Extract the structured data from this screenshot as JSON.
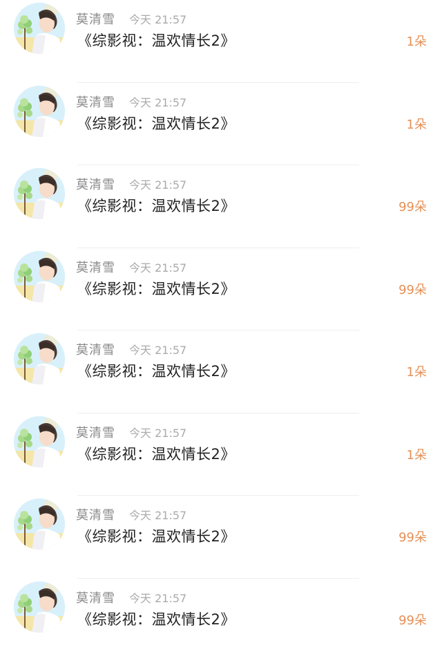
{
  "items": [
    {
      "name": "莫清雪",
      "time": "今天 21:57",
      "title": "《综影视：温欢情长2》",
      "amount": "1朵"
    },
    {
      "name": "莫清雪",
      "time": "今天 21:57",
      "title": "《综影视：温欢情长2》",
      "amount": "1朵"
    },
    {
      "name": "莫清雪",
      "time": "今天 21:57",
      "title": "《综影视：温欢情长2》",
      "amount": "99朵"
    },
    {
      "name": "莫清雪",
      "time": "今天 21:57",
      "title": "《综影视：温欢情长2》",
      "amount": "99朵"
    },
    {
      "name": "莫清雪",
      "time": "今天 21:57",
      "title": "《综影视：温欢情长2》",
      "amount": "1朵"
    },
    {
      "name": "莫清雪",
      "time": "今天 21:57",
      "title": "《综影视：温欢情长2》",
      "amount": "1朵"
    },
    {
      "name": "莫清雪",
      "time": "今天 21:57",
      "title": "《综影视：温欢情长2》",
      "amount": "99朵"
    },
    {
      "name": "莫清雪",
      "time": "今天 21:57",
      "title": "《综影视：温欢情长2》",
      "amount": "99朵"
    }
  ],
  "colors": {
    "amount": "#e69056",
    "name": "#8a8a8a",
    "time": "#aaaaaa",
    "title": "#222222"
  },
  "icons": {
    "avatar": "avatar-illustration"
  }
}
